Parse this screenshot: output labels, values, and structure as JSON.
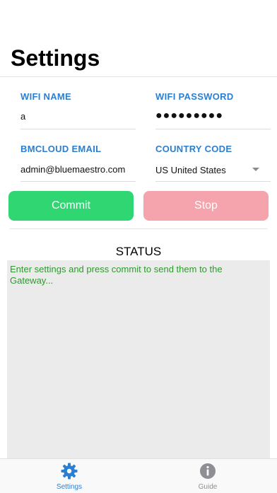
{
  "page": {
    "title": "Settings"
  },
  "form": {
    "wifi_name": {
      "label": "WIFI NAME",
      "value": "a"
    },
    "wifi_password": {
      "label": "WIFI PASSWORD",
      "value": "●●●●●●●●●"
    },
    "bmcloud_email": {
      "label": "BMCLOUD EMAIL",
      "value": "admin@bluemaestro.com"
    },
    "country_code": {
      "label": "COUNTRY CODE",
      "value": "US United States"
    }
  },
  "actions": {
    "commit_label": "Commit",
    "stop_label": "Stop"
  },
  "status": {
    "title": "STATUS",
    "message": "Enter settings and press commit to send them to the Gateway..."
  },
  "tabbar": {
    "settings_label": "Settings",
    "guide_label": "Guide",
    "active_color": "#2b7fd0",
    "inactive_color": "#8e8e93"
  },
  "colors": {
    "accent": "#2b7fd0",
    "commit": "#2fd672",
    "stop": "#f5a3ad",
    "status_text": "#2c9a2c"
  }
}
